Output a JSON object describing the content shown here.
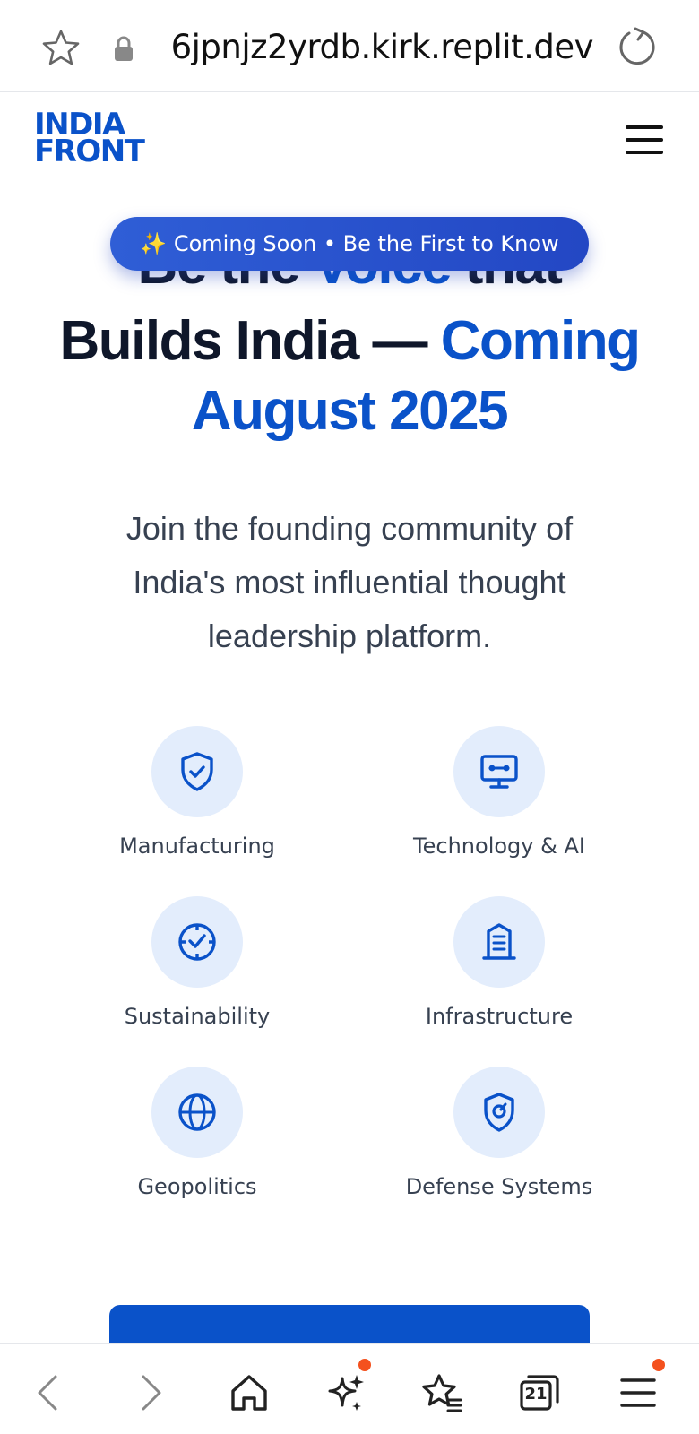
{
  "browser": {
    "url": "6jpnjz2yrdb.kirk.replit.dev",
    "tab_count": "21"
  },
  "site": {
    "logo_line1": "INDIA",
    "logo_line2": "FRONT"
  },
  "hero": {
    "badge": "✨ Coming Soon • Be the First to Know",
    "clipped_line_dark_1": "Be the ",
    "clipped_line_accent": "Voice",
    "clipped_line_dark_2": " that",
    "headline_dark": "Builds India — ",
    "headline_accent": "Coming August 2025",
    "subtitle": "Join the founding community of India's most influential thought leadership platform."
  },
  "categories": [
    {
      "label": "Manufacturing",
      "icon": "shield-check-icon"
    },
    {
      "label": "Technology & AI",
      "icon": "monitor-icon"
    },
    {
      "label": "Sustainability",
      "icon": "clock-check-icon"
    },
    {
      "label": "Infrastructure",
      "icon": "building-icon"
    },
    {
      "label": "Geopolitics",
      "icon": "globe-icon"
    },
    {
      "label": "Defense Systems",
      "icon": "shield-target-icon"
    }
  ],
  "colors": {
    "accent": "#0a52c9",
    "badge_bg": "#2f5ed6",
    "icon_circle": "#e3edfc",
    "notification": "#f4511e"
  }
}
